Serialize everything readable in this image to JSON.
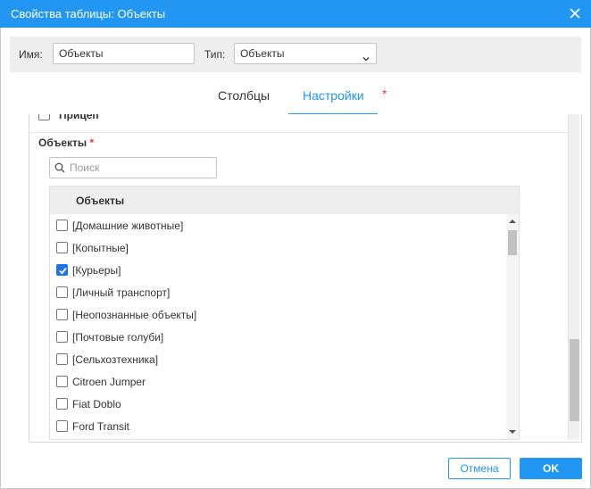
{
  "dialog": {
    "title": "Свойства таблицы: Объекты",
    "close_icon": "close-icon"
  },
  "properties": {
    "name_label": "Имя:",
    "name_value": "Объекты",
    "type_label": "Тип:",
    "type_value": "Объекты"
  },
  "tabs": [
    {
      "label": "Столбцы",
      "active": false
    },
    {
      "label": "Настройки",
      "active": true,
      "required_marker": "*"
    }
  ],
  "settings": {
    "partial_item_label": "Прицеп",
    "section_title": "Объекты",
    "required_marker": "*",
    "search_placeholder": "Поиск",
    "grid_header": "Объекты",
    "items": [
      {
        "label": "[Домашние животные]",
        "checked": false
      },
      {
        "label": "[Копытные]",
        "checked": false
      },
      {
        "label": "[Курьеры]",
        "checked": true
      },
      {
        "label": "[Личный транспорт]",
        "checked": false
      },
      {
        "label": "[Неопознанные объекты]",
        "checked": false
      },
      {
        "label": "[Почтовые голуби]",
        "checked": false
      },
      {
        "label": "[Сельхозтехника]",
        "checked": false
      },
      {
        "label": "Citroen Jumper",
        "checked": false
      },
      {
        "label": "Fiat Doblo",
        "checked": false
      },
      {
        "label": "Ford Transit",
        "checked": false
      }
    ]
  },
  "footer": {
    "cancel_label": "Отмена",
    "ok_label": "OK"
  },
  "colors": {
    "accent": "#2196f3",
    "required": "#e53935",
    "checkbox_checked": "#1e73e8"
  }
}
